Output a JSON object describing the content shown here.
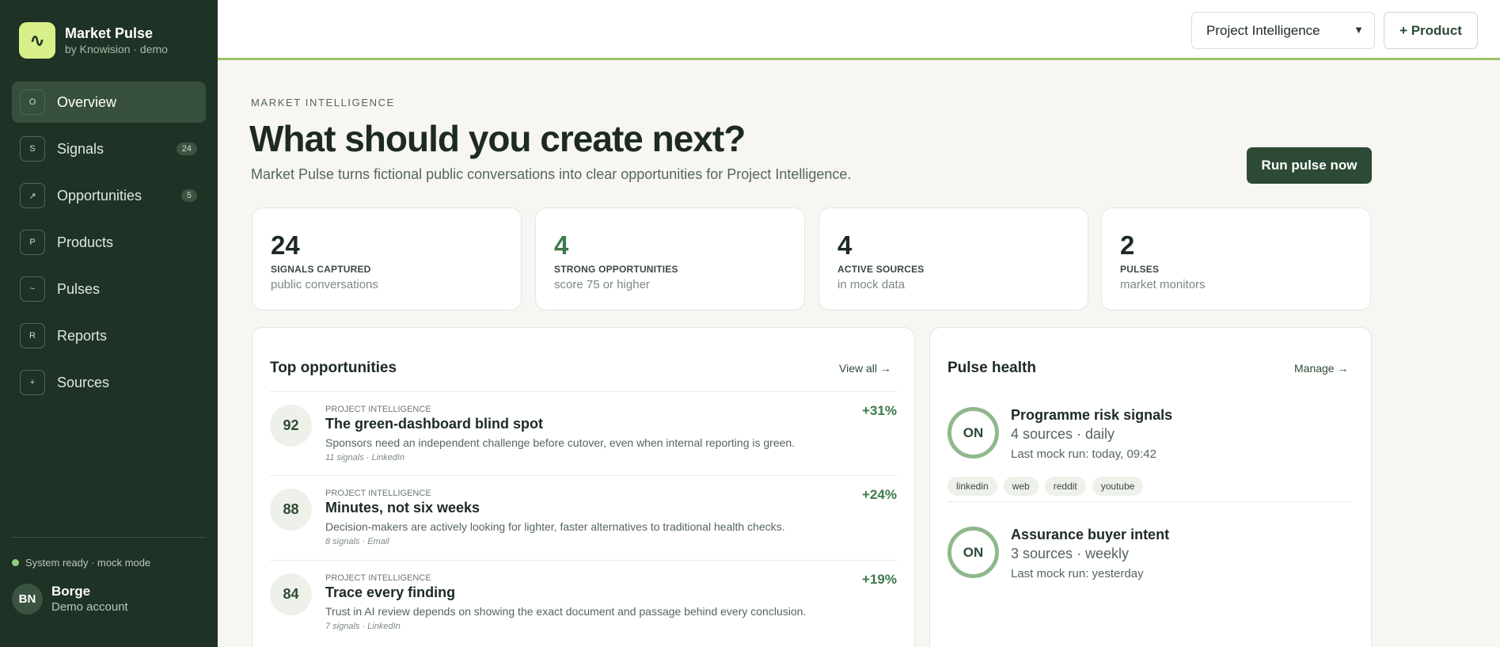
{
  "brand": {
    "logo_glyph": "∿",
    "name": "Market Pulse",
    "subtitle": "by Knowision · demo"
  },
  "nav": [
    {
      "icon": "O",
      "label": "Overview",
      "badge": ""
    },
    {
      "icon": "S",
      "label": "Signals",
      "badge": "24"
    },
    {
      "icon": "↗",
      "label": "Opportunities",
      "badge": "5"
    },
    {
      "icon": "P",
      "label": "Products",
      "badge": ""
    },
    {
      "icon": "~",
      "label": "Pulses",
      "badge": ""
    },
    {
      "icon": "R",
      "label": "Reports",
      "badge": ""
    },
    {
      "icon": "+",
      "label": "Sources",
      "badge": ""
    }
  ],
  "status": "System ready · mock mode",
  "user": {
    "initials": "BN",
    "name": "Borge",
    "role": "Demo account"
  },
  "topbar": {
    "product_select": "Project Intelligence",
    "add_product": "+ Product"
  },
  "hero": {
    "eyebrow": "MARKET INTELLIGENCE",
    "title": "What should you create next?",
    "subtitle": "Market Pulse turns fictional public conversations into clear opportunities for Project Intelligence.",
    "run_button": "Run pulse now"
  },
  "stats": [
    {
      "value": "24",
      "label": "SIGNALS CAPTURED",
      "sub": "public conversations"
    },
    {
      "value": "4",
      "label": "STRONG OPPORTUNITIES",
      "sub": "score 75 or higher"
    },
    {
      "value": "4",
      "label": "ACTIVE SOURCES",
      "sub": "in mock data"
    },
    {
      "value": "2",
      "label": "PULSES",
      "sub": "market monitors"
    }
  ],
  "opportunities": {
    "title": "Top opportunities",
    "view_all": "View all →",
    "items": [
      {
        "score": "92",
        "category": "PROJECT INTELLIGENCE",
        "title": "The green-dashboard blind spot",
        "description": "Sponsors need an independent challenge before cutover, even when internal reporting is green.",
        "meta": "11 signals · LinkedIn",
        "delta": "+31%"
      },
      {
        "score": "88",
        "category": "PROJECT INTELLIGENCE",
        "title": "Minutes, not six weeks",
        "description": "Decision-makers are actively looking for lighter, faster alternatives to traditional health checks.",
        "meta": "8 signals · Email",
        "delta": "+24%"
      },
      {
        "score": "84",
        "category": "PROJECT INTELLIGENCE",
        "title": "Trace every finding",
        "description": "Trust in AI review depends on showing the exact document and passage behind every conclusion.",
        "meta": "7 signals · LinkedIn",
        "delta": "+19%"
      }
    ]
  },
  "pulse_health": {
    "title": "Pulse health",
    "manage": "Manage →",
    "items": [
      {
        "state": "ON",
        "name": "Programme risk signals",
        "sources": "4 sources · daily",
        "last_run": "Last mock run: today, 09:42",
        "tags": [
          "linkedin",
          "web",
          "reddit",
          "youtube"
        ]
      },
      {
        "state": "ON",
        "name": "Assurance buyer intent",
        "sources": "3 sources · weekly",
        "last_run": "Last mock run: yesterday",
        "tags": []
      }
    ]
  }
}
